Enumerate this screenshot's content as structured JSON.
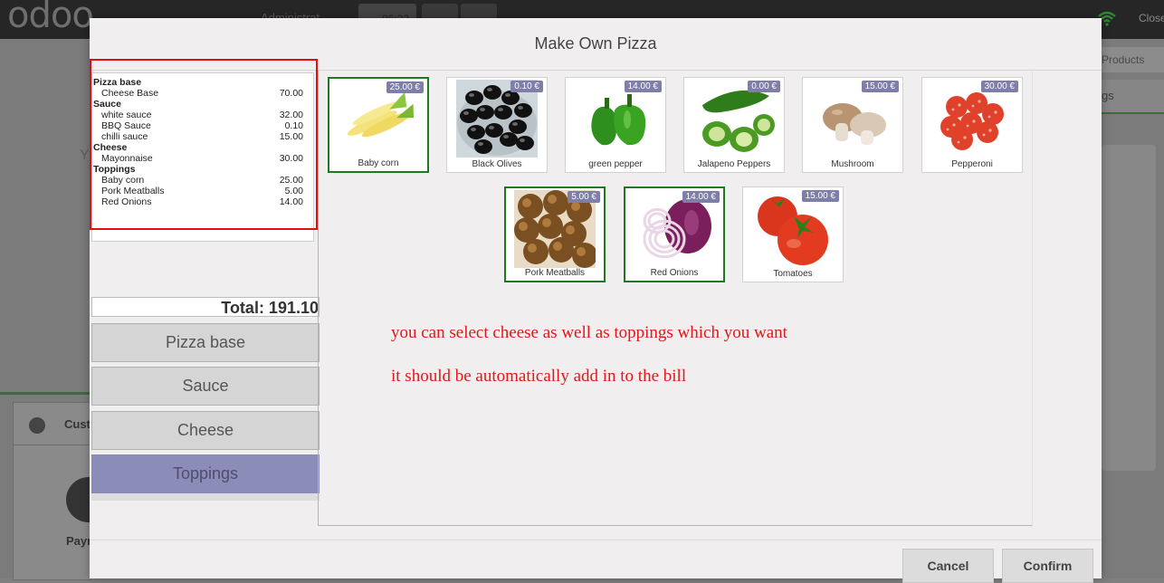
{
  "background": {
    "logo": "odoo",
    "user": "Administrat",
    "order_number": "05",
    "order_time": "06:22",
    "close_label": "Close",
    "products_label": "n Products",
    "right_tab": "gs",
    "customer_label": "Cust",
    "payment_label": "Payn",
    "side_letter": "Y"
  },
  "modal": {
    "title": "Make Own Pizza",
    "receipt": [
      {
        "type": "category",
        "name": "Pizza base"
      },
      {
        "type": "item",
        "name": "Cheese Base",
        "price": "70.00"
      },
      {
        "type": "category",
        "name": "Sauce"
      },
      {
        "type": "item",
        "name": "white sauce",
        "price": "32.00"
      },
      {
        "type": "item",
        "name": "BBQ Sauce",
        "price": "0.10"
      },
      {
        "type": "item",
        "name": "chilli sauce",
        "price": "15.00"
      },
      {
        "type": "category",
        "name": "Cheese"
      },
      {
        "type": "item",
        "name": "Mayonnaise",
        "price": "30.00"
      },
      {
        "type": "category",
        "name": "Toppings"
      },
      {
        "type": "item",
        "name": "Baby corn",
        "price": "25.00"
      },
      {
        "type": "item",
        "name": "Pork Meatballs",
        "price": "5.00"
      },
      {
        "type": "item",
        "name": "Red Onions",
        "price": "14.00"
      }
    ],
    "total_label": "Total: 191.10",
    "categories": [
      {
        "label": "Pizza base",
        "active": false
      },
      {
        "label": "Sauce",
        "active": false
      },
      {
        "label": "Cheese",
        "active": false
      },
      {
        "label": "Toppings",
        "active": true
      }
    ],
    "products": [
      {
        "name": "Baby corn",
        "price": "25.00 €",
        "selected": true,
        "icon": "baby-corn-image"
      },
      {
        "name": "Black Olives",
        "price": "0.10 €",
        "selected": false,
        "icon": "black-olives-image"
      },
      {
        "name": "green pepper",
        "price": "14.00 €",
        "selected": false,
        "icon": "green-pepper-image"
      },
      {
        "name": "Jalapeno Peppers",
        "price": "0.00 €",
        "selected": false,
        "icon": "jalapeno-image"
      },
      {
        "name": "Mushroom",
        "price": "15.00 €",
        "selected": false,
        "icon": "mushroom-image"
      },
      {
        "name": "Pepperoni",
        "price": "30.00 €",
        "selected": false,
        "icon": "pepperoni-image"
      },
      {
        "name": "Pork Meatballs",
        "price": "5.00 €",
        "selected": true,
        "icon": "meatballs-image"
      },
      {
        "name": "Red Onions",
        "price": "14.00 €",
        "selected": true,
        "icon": "red-onions-image"
      },
      {
        "name": "Tomatoes",
        "price": "15.00 €",
        "selected": false,
        "icon": "tomatoes-image"
      }
    ],
    "notes": [
      "you can select cheese as well as toppings which you want",
      "it should be automatically add in to the bill"
    ],
    "cancel_label": "Cancel",
    "confirm_label": "Confirm"
  },
  "colors": {
    "selected_border": "#1f7a1f",
    "price_badge": "#7e7ea8",
    "active_category": "#8c8cb8",
    "annotation_red": "#e01818"
  }
}
